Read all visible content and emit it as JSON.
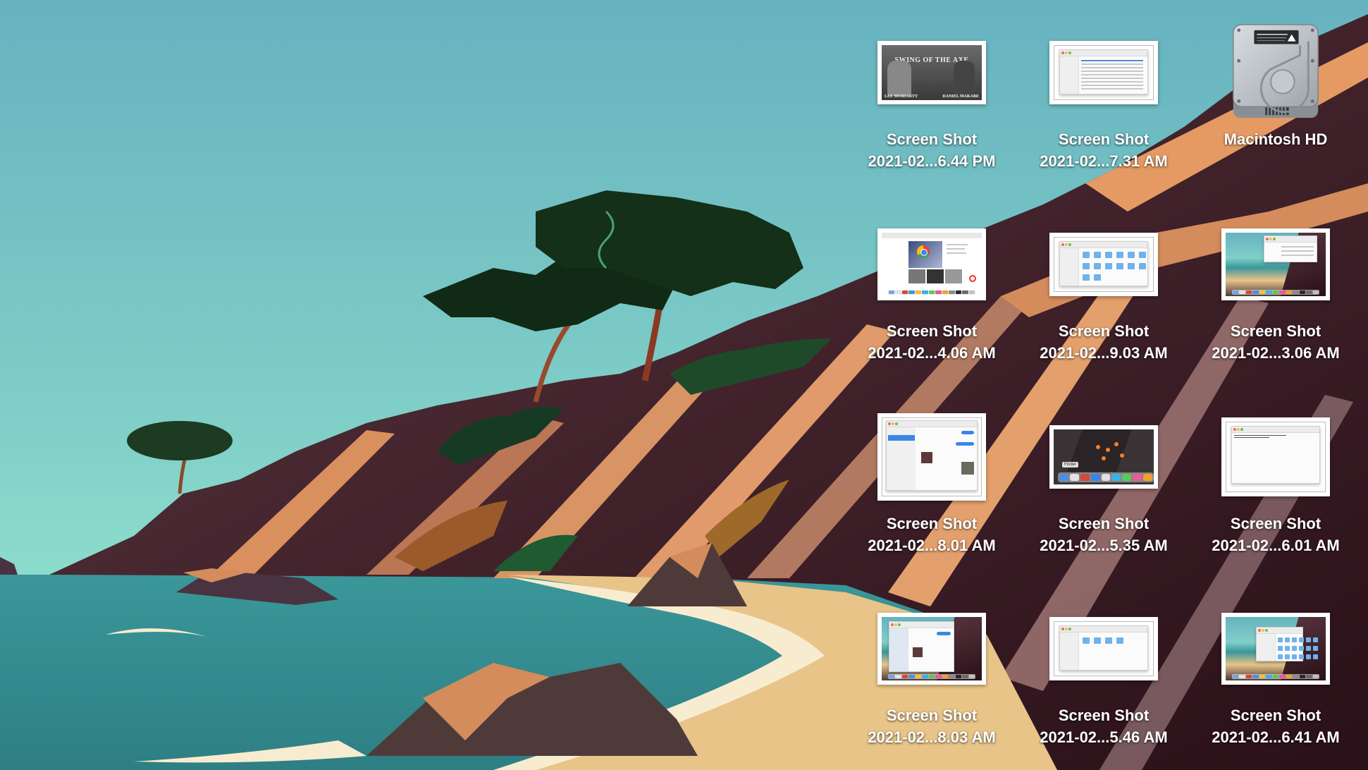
{
  "desktop": {
    "wallpaper": "macOS Big Sur coastal cliffs",
    "icons": [
      {
        "id": "hd",
        "type": "drive",
        "icon": "hard-drive-icon",
        "line1": "Macintosh HD",
        "line2": ""
      },
      {
        "id": "s1",
        "type": "screenshot",
        "preview": "wrestling-poster",
        "line1": "Screen Shot",
        "line2": "2021-02...6.44 PM"
      },
      {
        "id": "s2",
        "type": "screenshot",
        "preview": "finder-list",
        "line1": "Screen Shot",
        "line2": "2021-02...7.31 AM"
      },
      {
        "id": "s3",
        "type": "screenshot",
        "preview": "chrome-news",
        "line1": "Screen Shot",
        "line2": "2021-02...4.06 AM"
      },
      {
        "id": "s4",
        "type": "screenshot",
        "preview": "finder-icons",
        "line1": "Screen Shot",
        "line2": "2021-02...9.03 AM"
      },
      {
        "id": "s5",
        "type": "screenshot",
        "preview": "desktop-finder",
        "line1": "Screen Shot",
        "line2": "2021-02...3.06 AM"
      },
      {
        "id": "s6",
        "type": "screenshot",
        "preview": "messages",
        "line1": "Screen Shot",
        "line2": "2021-02...8.01 AM"
      },
      {
        "id": "s7",
        "type": "screenshot",
        "preview": "dock-finder-tooltip",
        "line1": "Screen Shot",
        "line2": "2021-02...5.35 AM"
      },
      {
        "id": "s8",
        "type": "screenshot",
        "preview": "terminal",
        "line1": "Screen Shot",
        "line2": "2021-02...6.01 AM"
      },
      {
        "id": "s9",
        "type": "screenshot",
        "preview": "desktop-messages",
        "line1": "Screen Shot",
        "line2": "2021-02...8.03 AM"
      },
      {
        "id": "s10",
        "type": "screenshot",
        "preview": "finder-macintosh-hd",
        "line1": "Screen Shot",
        "line2": "2021-02...5.46 AM"
      },
      {
        "id": "s11",
        "type": "screenshot",
        "preview": "desktop-finder-grid",
        "line1": "Screen Shot",
        "line2": "2021-02...6.41 AM"
      }
    ],
    "thumb_texts": {
      "poster_title": "SWING OF THE AXE",
      "poster_left": "LEE MORIARTY",
      "poster_right": "DANIEL MAKABE",
      "dock_tooltip": "Finder"
    }
  }
}
